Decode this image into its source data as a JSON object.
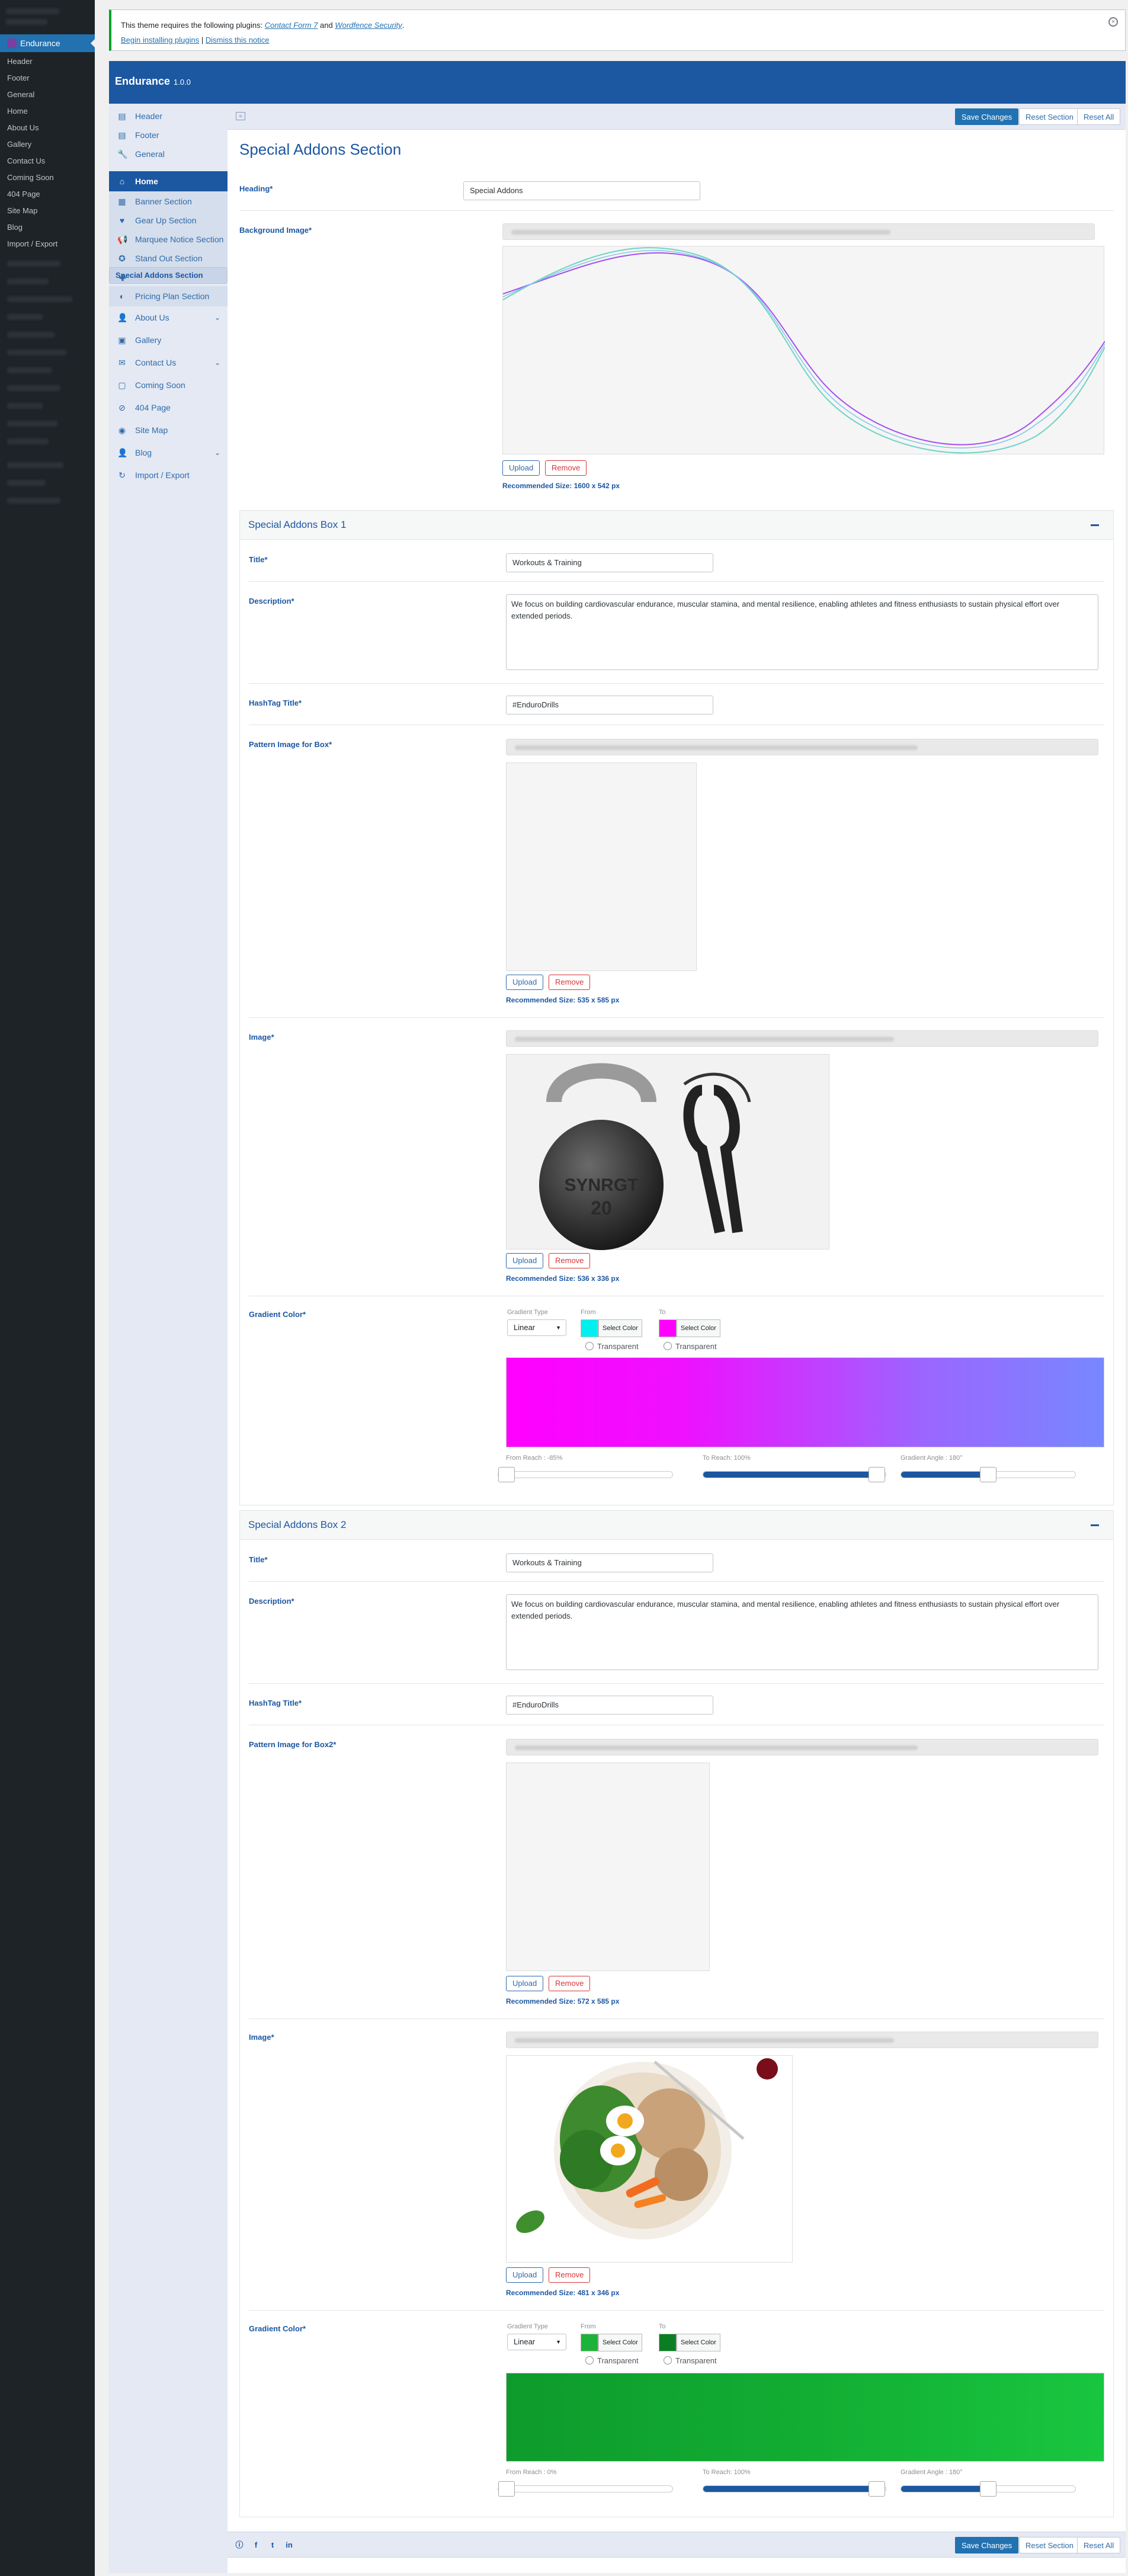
{
  "wp": {
    "menu_title": "Endurance",
    "items": [
      "Header",
      "Footer",
      "General",
      "Home",
      "About Us",
      "Gallery",
      "Contact Us",
      "Coming Soon",
      "404 Page",
      "Site Map",
      "Blog",
      "Import / Export"
    ]
  },
  "notice": {
    "prefix": "This theme requires the following plugins: ",
    "plugin1": "Contact Form 7",
    "and": " and ",
    "plugin2": "Wordfence Security",
    "suffix": ".",
    "begin": "Begin installing plugins",
    "sep": " | ",
    "dismiss": "Dismiss this notice"
  },
  "header": {
    "title": "Endurance",
    "version": "1.0.0"
  },
  "sidebar": {
    "items": [
      {
        "label": "Header",
        "icon": "header-icon"
      },
      {
        "label": "Footer",
        "icon": "footer-icon"
      },
      {
        "label": "General",
        "icon": "wrench-icon"
      },
      {
        "label": "Home",
        "icon": "home-icon"
      },
      {
        "label": "Banner Section",
        "icon": "banner-icon"
      },
      {
        "label": "Gear Up Section",
        "icon": "heart-icon"
      },
      {
        "label": "Marquee Notice Section",
        "icon": "megaphone-icon"
      },
      {
        "label": "Stand Out Section",
        "icon": "star-icon"
      },
      {
        "label": "Special Addons Section",
        "icon": "puzzle-icon"
      },
      {
        "label": "Pricing Plan Section",
        "icon": "tag-icon"
      },
      {
        "label": "About Us",
        "icon": "user-icon"
      },
      {
        "label": "Gallery",
        "icon": "gallery-icon"
      },
      {
        "label": "Contact Us",
        "icon": "mail-icon"
      },
      {
        "label": "Coming Soon",
        "icon": "square-icon"
      },
      {
        "label": "404 Page",
        "icon": "block-icon"
      },
      {
        "label": "Site Map",
        "icon": "sitemap-icon"
      },
      {
        "label": "Blog",
        "icon": "user-icon"
      },
      {
        "label": "Import / Export",
        "icon": "refresh-icon"
      }
    ]
  },
  "toolbar": {
    "save": "Save Changes",
    "reset_section": "Reset Section",
    "reset_all": "Reset All"
  },
  "section": {
    "title": "Special Addons Section",
    "heading_label": "Heading*",
    "heading_value": "Special Addons",
    "bg_label": "Background Image*",
    "bg_rec": "Recommended Size: 1600 x 542 px",
    "upload": "Upload",
    "remove": "Remove"
  },
  "box1": {
    "head": "Special Addons Box 1",
    "title_label": "Title*",
    "title_value": "Workouts & Training",
    "desc_label": "Description*",
    "desc_value": "We focus on building cardiovascular endurance, muscular stamina, and mental resilience, enabling athletes and fitness enthusiasts to sustain physical effort over extended periods.",
    "hash_label": "HashTag Title*",
    "hash_value": "#EnduroDrills",
    "pattern_label": "Pattern Image for Box*",
    "pattern_rec": "Recommended Size: 535 x 585 px",
    "image_label": "Image*",
    "image_rec": "Recommended Size: 536 x 336 px",
    "grad_label": "Gradient Color*",
    "grad_type_label": "Gradient Type",
    "grad_type": "Linear",
    "from_label": "From",
    "to_label": "To",
    "select_color": "Select Color",
    "transparent": "Transparent",
    "from_color": "#00f0f0",
    "to_color": "#ff00ff",
    "from_reach_label": "From Reach : -85%",
    "to_reach_label": "To Reach: 100%",
    "angle_label": "Gradient Angle : 180°",
    "from_reach": 0.0,
    "to_reach": 0.95,
    "angle": 0.5,
    "grad_css": "linear-gradient(90deg,#ff00ff 0%,#ee11ff 30%,#9b66ff 70%,#7788ff 100%)"
  },
  "box2": {
    "head": "Special Addons Box 2",
    "title_label": "Title*",
    "title_value": "Workouts & Training",
    "desc_label": "Description*",
    "desc_value": "We focus on building cardiovascular endurance, muscular stamina, and mental resilience, enabling athletes and fitness enthusiasts to sustain physical effort over extended periods.",
    "hash_label": "HashTag Title*",
    "hash_value": "#EnduroDrills",
    "pattern_label": "Pattern Image for Box2*",
    "pattern_rec": "Recommended Size: 572 x 585 px",
    "image_label": "Image*",
    "image_rec": "Recommended Size: 481 x 346 px",
    "grad_label": "Gradient Color*",
    "grad_type_label": "Gradient Type",
    "grad_type": "Linear",
    "from_label": "From",
    "to_label": "To",
    "select_color": "Select Color",
    "transparent": "Transparent",
    "from_color": "#1db33a",
    "to_color": "#0b7e23",
    "from_reach_label": "From Reach : 0%",
    "to_reach_label": "To Reach: 100%",
    "angle_label": "Gradient Angle : 180°",
    "from_reach": 0.0,
    "to_reach": 0.95,
    "angle": 0.5,
    "grad_css": "linear-gradient(90deg,#0e9b2c 0%,#12ad33 50%,#19c640 100%)"
  },
  "colors": {
    "accent": "#1c57a1",
    "wp_blue": "#2271b1",
    "sidebar_bg": "#e4e9f3",
    "admin_bar": "#1d2327"
  }
}
